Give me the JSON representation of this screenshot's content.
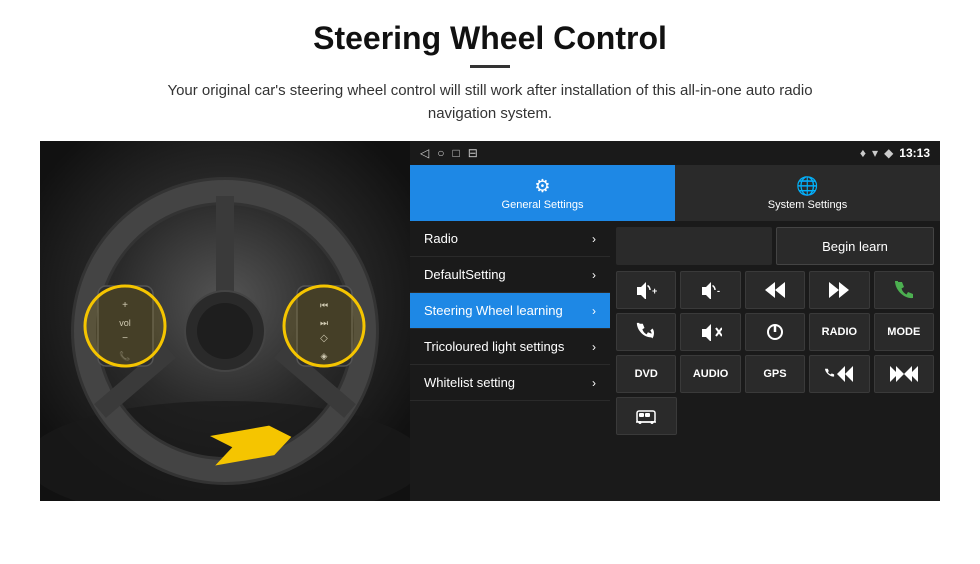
{
  "page": {
    "title": "Steering Wheel Control",
    "subtitle": "Your original car's steering wheel control will still work after installation of this all-in-one auto radio navigation system.",
    "divider": "—"
  },
  "status_bar": {
    "nav_back": "◁",
    "nav_home": "○",
    "nav_recent": "□",
    "nav_menu": "⊟",
    "signal": "▾◆",
    "time": "13:13",
    "location_icon": "♦"
  },
  "tabs": [
    {
      "id": "general",
      "label": "General Settings",
      "icon": "⚙",
      "active": true
    },
    {
      "id": "system",
      "label": "System Settings",
      "icon": "⊕",
      "active": false
    }
  ],
  "menu_items": [
    {
      "id": "radio",
      "label": "Radio",
      "active": false
    },
    {
      "id": "default",
      "label": "DefaultSetting",
      "active": false
    },
    {
      "id": "steering",
      "label": "Steering Wheel learning",
      "active": true
    },
    {
      "id": "tricoloured",
      "label": "Tricoloured light settings",
      "active": false
    },
    {
      "id": "whitelist",
      "label": "Whitelist setting",
      "active": false
    }
  ],
  "controls": {
    "begin_learn": "Begin learn",
    "row1": [
      {
        "icon": "🔊+",
        "label": "vol_up"
      },
      {
        "icon": "🔊-",
        "label": "vol_down"
      },
      {
        "icon": "⏮",
        "label": "prev"
      },
      {
        "icon": "⏭",
        "label": "next"
      },
      {
        "icon": "📞",
        "label": "phone"
      }
    ],
    "row2": [
      {
        "icon": "📞",
        "label": "answer"
      },
      {
        "icon": "🔇",
        "label": "mute"
      },
      {
        "icon": "⏻",
        "label": "power"
      },
      {
        "text": "RADIO",
        "label": "radio"
      },
      {
        "text": "MODE",
        "label": "mode"
      }
    ],
    "row3": [
      {
        "text": "DVD",
        "label": "dvd"
      },
      {
        "text": "AUDIO",
        "label": "audio"
      },
      {
        "text": "GPS",
        "label": "gps"
      },
      {
        "icon": "📞⏮",
        "label": "phone_prev"
      },
      {
        "icon": "⏮⏭",
        "label": "prev_next"
      }
    ],
    "row4": [
      {
        "icon": "🚌",
        "label": "bus"
      }
    ]
  }
}
